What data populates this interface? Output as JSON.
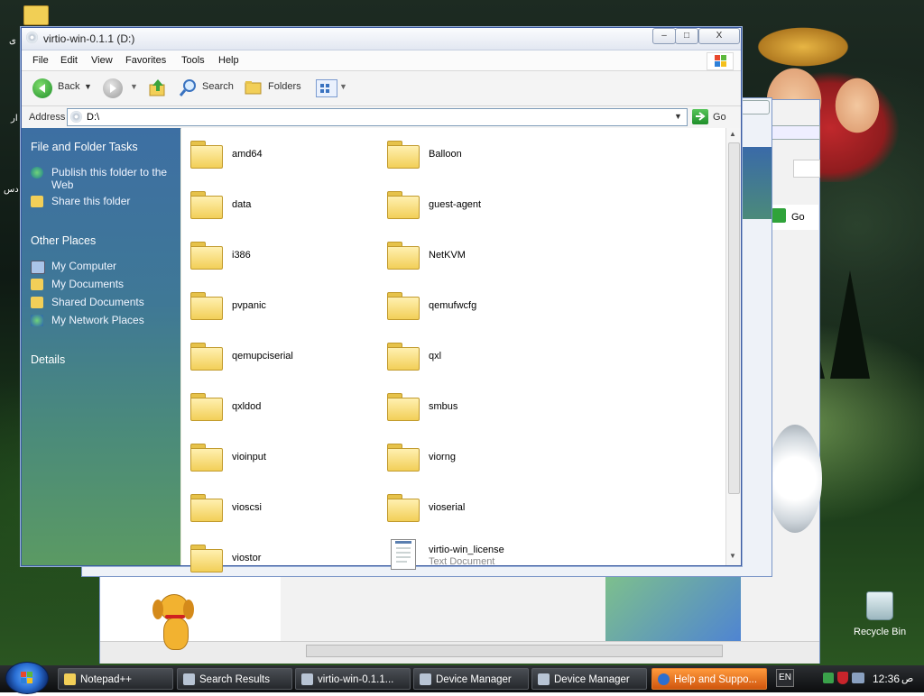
{
  "window": {
    "title": "virtio-win-0.1.1 (D:)",
    "controls": {
      "minimize": "–",
      "maximize": "□",
      "close": "X"
    }
  },
  "menubar": [
    "File",
    "Edit",
    "View",
    "Favorites",
    "Tools",
    "Help"
  ],
  "toolbar": {
    "back_label": "Back",
    "search_label": "Search",
    "folders_label": "Folders"
  },
  "addressbar": {
    "label": "Address",
    "value": "D:\\",
    "go_label": "Go"
  },
  "tasks": {
    "file_folder_title": "File and Folder Tasks",
    "file_folder_items": [
      "Publish this folder to the Web",
      "Share this folder"
    ],
    "other_places_title": "Other Places",
    "other_places_items": [
      "My Computer",
      "My Documents",
      "Shared Documents",
      "My Network Places"
    ],
    "details_title": "Details"
  },
  "files": [
    {
      "name": "amd64",
      "type": "folder"
    },
    {
      "name": "Balloon",
      "type": "folder"
    },
    {
      "name": "data",
      "type": "folder"
    },
    {
      "name": "guest-agent",
      "type": "folder"
    },
    {
      "name": "i386",
      "type": "folder"
    },
    {
      "name": "NetKVM",
      "type": "folder"
    },
    {
      "name": "pvpanic",
      "type": "folder"
    },
    {
      "name": "qemufwcfg",
      "type": "folder"
    },
    {
      "name": "qemupciserial",
      "type": "folder"
    },
    {
      "name": "qxl",
      "type": "folder"
    },
    {
      "name": "qxldod",
      "type": "folder"
    },
    {
      "name": "smbus",
      "type": "folder"
    },
    {
      "name": "vioinput",
      "type": "folder"
    },
    {
      "name": "viorng",
      "type": "folder"
    },
    {
      "name": "vioscsi",
      "type": "folder"
    },
    {
      "name": "vioserial",
      "type": "folder"
    },
    {
      "name": "viostor",
      "type": "folder"
    },
    {
      "name": "virtio-win_license",
      "type": "text",
      "subtitle": "Text Document"
    }
  ],
  "background_window": {
    "go_label": "Go"
  },
  "desktop": {
    "recycle_bin": "Recycle Bin"
  },
  "taskbar": {
    "buttons": [
      {
        "label": "Notepad++"
      },
      {
        "label": "Search Results"
      },
      {
        "label": "virtio-win-0.1.1..."
      },
      {
        "label": "Device Manager"
      },
      {
        "label": "Device Manager"
      },
      {
        "label": "Help and Suppo..."
      }
    ],
    "language": "EN",
    "clock": "12:36",
    "ampm": "ص"
  },
  "colors": {
    "taskpane_top": "#3d6fa3",
    "taskpane_bottom": "#5b9a63",
    "taskbar_active": "#d0560e"
  }
}
